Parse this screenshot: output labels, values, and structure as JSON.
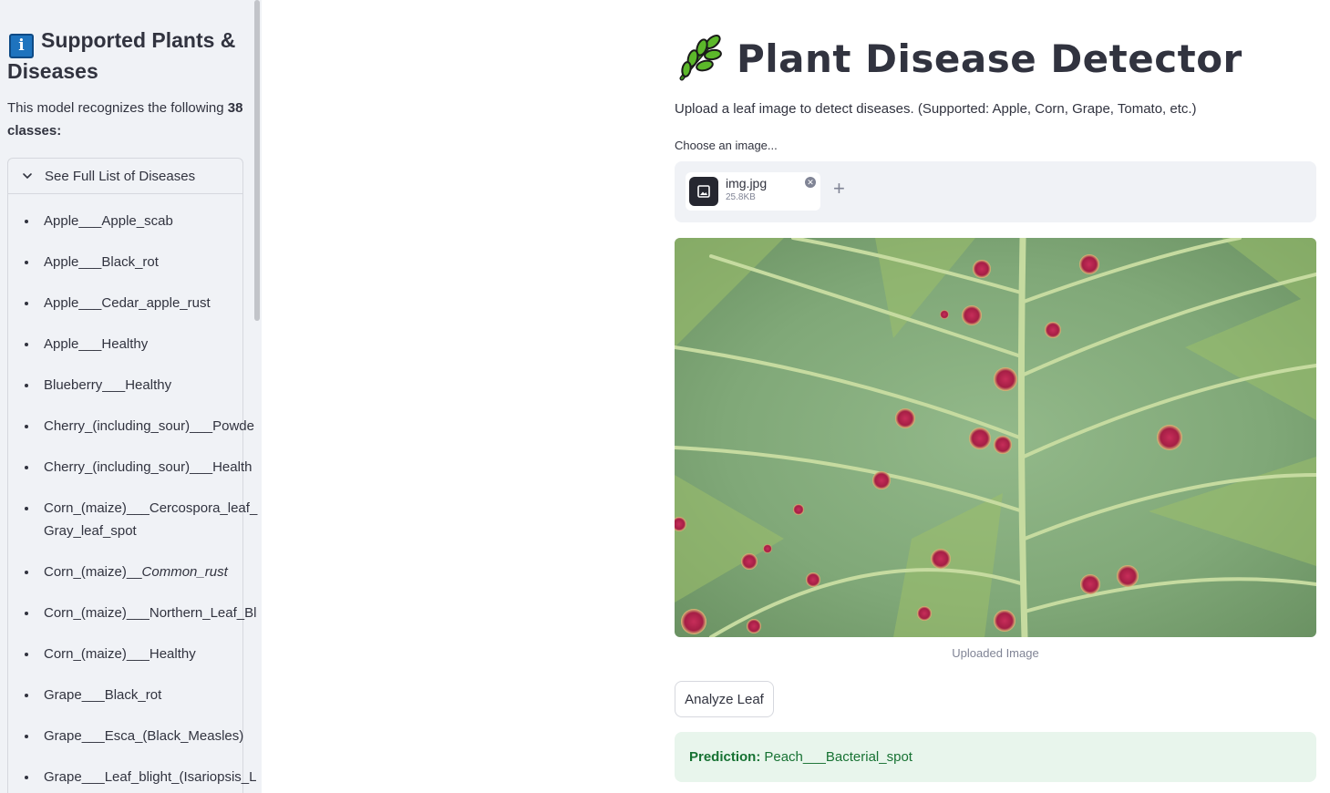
{
  "sidebar": {
    "title": "Supported Plants & Diseases",
    "info_icon": "i",
    "desc_prefix": "This model recognizes the following ",
    "class_count": "38",
    "desc_suffix": " classes:",
    "expander_label": "See Full List of Diseases",
    "diseases": [
      "Apple___Apple_scab",
      "Apple___Black_rot",
      "Apple___Cedar_apple_rust",
      "Apple___Healthy",
      "Blueberry___Healthy",
      "Cherry_(including_sour)___Powde",
      "Cherry_(including_sour)___Health",
      "Corn_(maize)___Cercospora_leaf_",
      "Gray_leaf_spot",
      "Corn_(maize)__",
      "Common_rust",
      "Corn_(maize)___Northern_Leaf_Bl",
      "Corn_(maize)___Healthy",
      "Grape___Black_rot",
      "Grape___Esca_(Black_Measles)",
      "Grape___Leaf_blight_(Isariopsis_L"
    ]
  },
  "main": {
    "title": "Plant Disease Detector",
    "subtitle": "Upload a leaf image to detect diseases. (Supported: Apple, Corn, Grape, Tomato, etc.)",
    "choose_label": "Choose an image...",
    "file": {
      "name": "img.jpg",
      "size": "25.8KB"
    },
    "add_symbol": "+",
    "caption": "Uploaded Image",
    "analyze_label": "Analyze Leaf",
    "prediction_label": "Prediction:",
    "prediction_value": "Peach___Bacterial_spot"
  },
  "colors": {
    "sidebar_bg": "#f0f2f6",
    "text": "#31333f",
    "success_bg": "#e8f5ec",
    "success_text": "#177233",
    "info_badge": "#1e73be",
    "leaf_green": "#7fa86e",
    "spot_red": "#b0224a"
  },
  "icons": [
    "info-icon",
    "chevron-down-icon",
    "herb-icon",
    "image-file-icon",
    "close-icon",
    "plus-icon"
  ]
}
